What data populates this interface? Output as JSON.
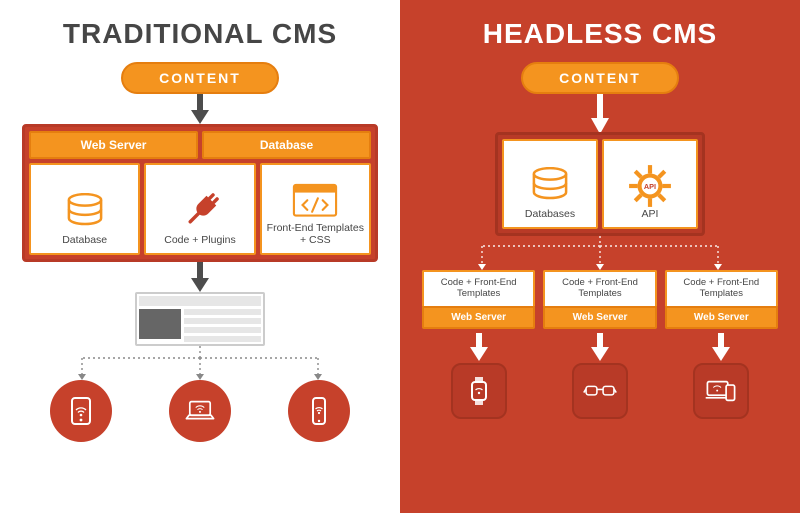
{
  "left": {
    "title": "TRADITIONAL CMS",
    "content_pill": "CONTENT",
    "tabs": {
      "web_server": "Web Server",
      "database": "Database"
    },
    "cards": {
      "db": "Database",
      "code": "Code + Plugins",
      "fe": "Front-End Templates + CSS"
    },
    "devices": [
      "tablet",
      "laptop",
      "phone"
    ]
  },
  "right": {
    "title": "HEADLESS CMS",
    "content_pill": "CONTENT",
    "api_cards": {
      "db": "Databases",
      "api": "API"
    },
    "fe_block": {
      "top": "Code + Front-End Templates",
      "bottom": "Web Server"
    },
    "devices": [
      "watch",
      "glasses",
      "multi"
    ]
  }
}
